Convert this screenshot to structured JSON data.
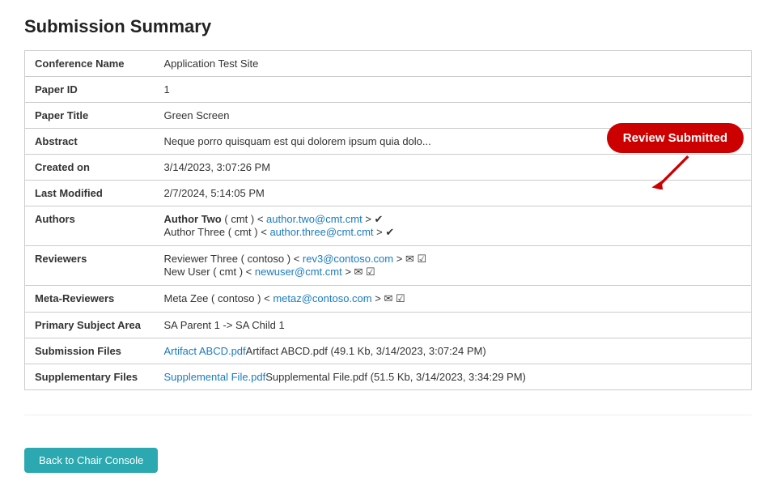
{
  "page": {
    "title": "Submission Summary",
    "back_button_label": "Back to Chair Console"
  },
  "table": {
    "rows": [
      {
        "label": "Conference Name",
        "value": "Application Test Site",
        "type": "text"
      },
      {
        "label": "Paper ID",
        "value": "1",
        "type": "text"
      },
      {
        "label": "Paper Title",
        "value": "Green Screen",
        "type": "text"
      },
      {
        "label": "Abstract",
        "value": "Neque porro quisquam est qui dolorem ipsum quia dolo...",
        "type": "text"
      },
      {
        "label": "Created on",
        "value": "3/14/2023, 3:07:26 PM",
        "type": "blue"
      },
      {
        "label": "Last Modified",
        "value": "2/7/2024, 5:14:05 PM",
        "type": "blue"
      },
      {
        "label": "Authors",
        "value": "authors",
        "type": "authors"
      },
      {
        "label": "Reviewers",
        "value": "reviewers",
        "type": "reviewers"
      },
      {
        "label": "Meta-Reviewers",
        "value": "meta-reviewers",
        "type": "meta-reviewers"
      },
      {
        "label": "Primary Subject Area",
        "value": "SA Parent 1 -> SA Child 1",
        "type": "blue"
      },
      {
        "label": "Submission Files",
        "value": "submission-files",
        "type": "files1"
      },
      {
        "label": "Supplementary Files",
        "value": "supplementary-files",
        "type": "files2"
      }
    ],
    "authors": [
      {
        "name": "Author Two",
        "org": "cmt",
        "email": "author.two@cmt.cmt",
        "check": true
      },
      {
        "name": "Author Three",
        "org": "cmt",
        "email": "author.three@cmt.cmt",
        "check": true
      }
    ],
    "reviewers": [
      {
        "name": "Reviewer Three",
        "org": "contoso",
        "email": "rev3@contoso.com",
        "icons": "email-check"
      },
      {
        "name": "New User",
        "org": "cmt",
        "email": "newuser@cmt.cmt",
        "icons": "email-check"
      }
    ],
    "meta_reviewers": [
      {
        "name": "Meta Zee",
        "org": "contoso",
        "email": "metaz@contoso.com",
        "icons": "email-check"
      }
    ],
    "submission_files": {
      "link_text": "Artifact ABCD.pdf",
      "link_text2": "Artifact ABCD.pdf",
      "meta": "(49.1 Kb, 3/14/2023, 3:07:24 PM)"
    },
    "supplementary_files": {
      "link_text": "Supplemental File.pdf",
      "link_text2": "Supplemental File.pdf",
      "meta": "(51.5 Kb, 3/14/2023, 3:34:29 PM)"
    }
  },
  "callout": {
    "label": "Review Submitted"
  }
}
